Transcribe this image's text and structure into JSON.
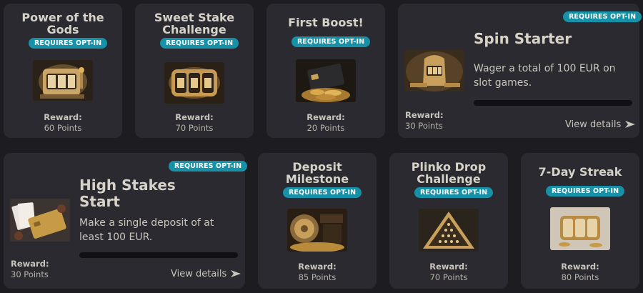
{
  "badge_text": "REQUIRES OPT-IN",
  "reward_label": "Reward:",
  "view_details": "View details",
  "cards": {
    "power_of_the_gods": {
      "title_line1": "Power of the",
      "title_line2": "Gods",
      "reward": "60 Points",
      "thumb_icon": "slot-machine-image"
    },
    "sweet_stake_challenge": {
      "title_line1": "Sweet Stake",
      "title_line2": "Challenge",
      "reward": "70 Points",
      "thumb_icon": "slot-reels-image"
    },
    "first_boost": {
      "title": "First Boost!",
      "reward": "20 Points",
      "thumb_icon": "credit-card-coins-image"
    },
    "spin_starter": {
      "title": "Spin Starter",
      "description_line1": "Wager a total of 100 EUR on",
      "description_line2": "slot games.",
      "reward": "30 Points",
      "progress": 0,
      "thumb_icon": "golden-slot-machine-image"
    },
    "high_stakes_start": {
      "title_line1": "High Stakes",
      "title_line2": "Start",
      "description_line1": "Make a single deposit of at",
      "description_line2": "least 100 EUR.",
      "reward": "30 Points",
      "progress": 0,
      "thumb_icon": "cards-and-credit-card-image"
    },
    "deposit_milestone": {
      "title_line1": "Deposit",
      "title_line2": "Milestone",
      "reward": "85 Points",
      "thumb_icon": "vault-deposit-image"
    },
    "plinko_drop_challenge": {
      "title_line1": "Plinko Drop",
      "title_line2": "Challenge",
      "reward": "70 Points",
      "thumb_icon": "plinko-pyramid-image"
    },
    "seven_day_streak": {
      "title": "7-Day Streak",
      "reward": "80 Points",
      "thumb_icon": "golden-reels-image"
    }
  },
  "colors": {
    "page_bg": "#1d1c21",
    "card_bg": "#2b2a30",
    "badge_bg": "#1791a8",
    "progress_track": "#111015",
    "gold": "#c79a45"
  }
}
